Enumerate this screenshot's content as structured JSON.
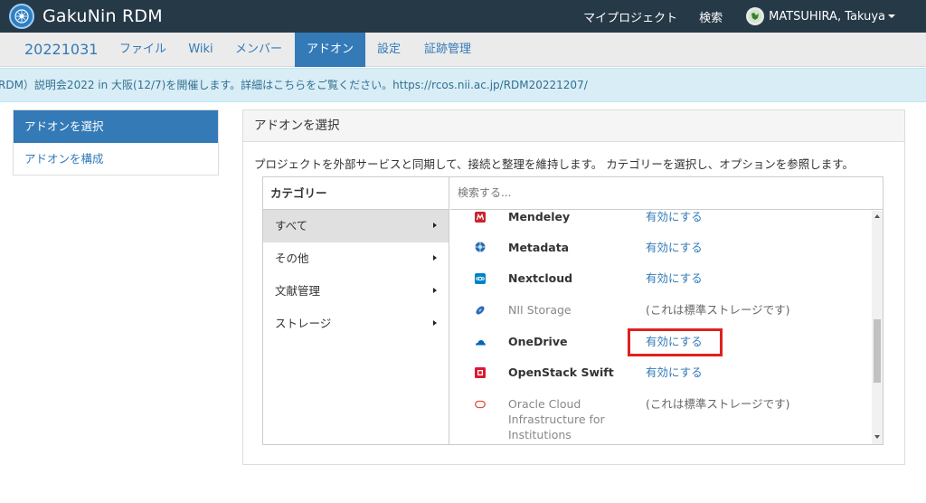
{
  "header": {
    "brand": "GakuNin RDM",
    "my_projects": "マイプロジェクト",
    "search": "検索",
    "user_name": "MATSUHIRA, Takuya"
  },
  "project_nav": {
    "title": "20221031",
    "tabs": [
      {
        "label": "ファイル",
        "active": false
      },
      {
        "label": "Wiki",
        "active": false
      },
      {
        "label": "メンバー",
        "active": false
      },
      {
        "label": "アドオン",
        "active": true
      },
      {
        "label": "設定",
        "active": false
      },
      {
        "label": "証跡管理",
        "active": false
      }
    ]
  },
  "announcement": "RDM）説明会2022 in 大阪(12/7)を開催します。詳細はこちらをご覧ください。https://rcos.nii.ac.jp/RDM20221207/",
  "sidebar": {
    "items": [
      {
        "label": "アドオンを選択",
        "active": true
      },
      {
        "label": "アドオンを構成",
        "active": false
      }
    ]
  },
  "panel": {
    "title": "アドオンを選択",
    "description": "プロジェクトを外部サービスと同期して、接続と整理を維持します。 カテゴリーを選択し、オプションを参照します。"
  },
  "categories": {
    "header": "カテゴリー",
    "items": [
      {
        "label": "すべて",
        "active": true
      },
      {
        "label": "その他",
        "active": false
      },
      {
        "label": "文献管理",
        "active": false
      },
      {
        "label": "ストレージ",
        "active": false
      }
    ]
  },
  "search": {
    "placeholder": "検索する..."
  },
  "addons": [
    {
      "name": "Mendeley",
      "action": "有効にする",
      "enabled_action": true,
      "icon": "mendeley-icon",
      "color": "#c8232c"
    },
    {
      "name": "Metadata",
      "action": "有効にする",
      "enabled_action": true,
      "icon": "metadata-icon",
      "color": "#2b6cb0"
    },
    {
      "name": "Nextcloud",
      "action": "有効にする",
      "enabled_action": true,
      "icon": "nextcloud-icon",
      "color": "#0082c9"
    },
    {
      "name": "NII Storage",
      "action": "(これは標準ストレージです)",
      "enabled_action": false,
      "icon": "nii-storage-icon",
      "color": "#2a6ab8"
    },
    {
      "name": "OneDrive",
      "action": "有効にする",
      "enabled_action": true,
      "icon": "onedrive-icon",
      "color": "#0364b8"
    },
    {
      "name": "OpenStack Swift",
      "action": "有効にする",
      "enabled_action": true,
      "icon": "openstack-icon",
      "color": "#da1a32"
    },
    {
      "name": "Oracle Cloud Infrastructure for Institutions",
      "action": "(これは標準ストレージです)",
      "enabled_action": false,
      "icon": "oracle-cloud-icon",
      "color": "#e64b3c"
    }
  ],
  "colors": {
    "navbar": "#263947",
    "accent": "#337ab7",
    "highlight": "#e0201f",
    "announce_bg": "#d9edf7"
  }
}
